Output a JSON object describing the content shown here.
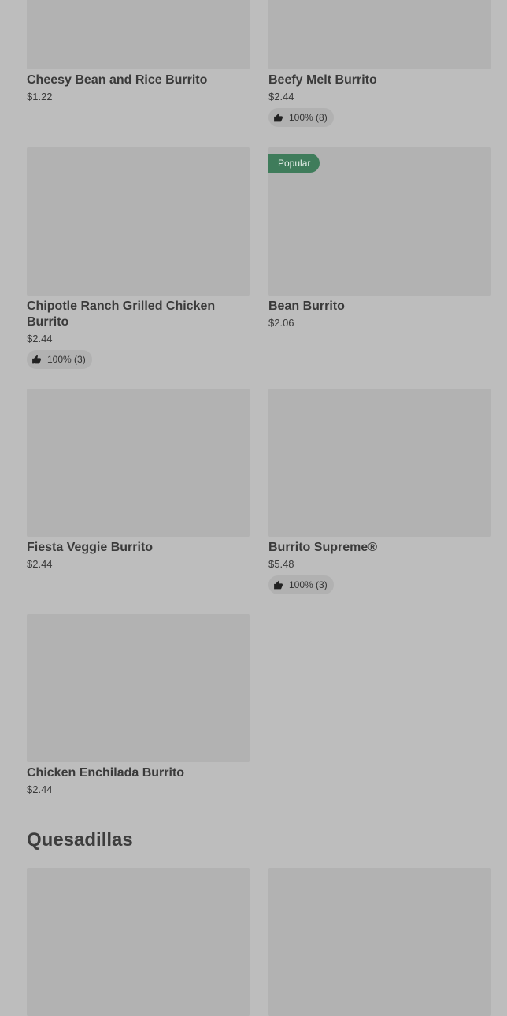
{
  "items": [
    {
      "name": "Cheesy Bean and Rice Burrito",
      "price": "$1.22"
    },
    {
      "name": "Beefy Melt Burrito",
      "price": "$2.44",
      "rating": "100% (8)"
    },
    {
      "name": "Chipotle Ranch Grilled Chicken Burrito",
      "price": "$2.44",
      "rating": "100% (3)"
    },
    {
      "name": "Bean Burrito",
      "price": "$2.06",
      "badge": "Popular"
    },
    {
      "name": "Fiesta Veggie Burrito",
      "price": "$2.44"
    },
    {
      "name": "Burrito Supreme®",
      "price": "$5.48",
      "rating": "100% (3)"
    },
    {
      "name": "Chicken Enchilada Burrito",
      "price": "$2.44"
    }
  ],
  "sections": {
    "quesadillas_title": "Quesadillas"
  },
  "icons": {
    "rating": "thumbs-up-icon"
  },
  "colors": {
    "popular_badge": "#3f7c5b"
  }
}
